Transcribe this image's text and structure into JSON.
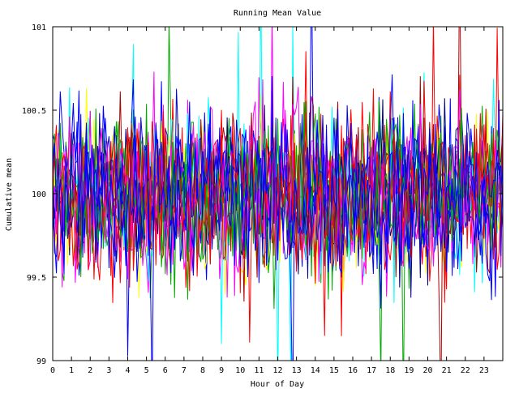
{
  "chart_data": {
    "type": "line",
    "title": "Running Mean Value",
    "xlabel": "Hour of Day",
    "ylabel": "Cumulative mean",
    "xlim": [
      0,
      24
    ],
    "ylim": [
      99,
      101
    ],
    "x_ticks": [
      "0",
      "1",
      "2",
      "3",
      "4",
      "5",
      "6",
      "7",
      "8",
      "9",
      "10",
      "11",
      "12",
      "13",
      "14",
      "15",
      "16",
      "17",
      "18",
      "19",
      "20",
      "21",
      "22",
      "23"
    ],
    "y_ticks": [
      "99",
      "99.5",
      "100",
      "100.5",
      "101"
    ],
    "grid": false,
    "legend": "none",
    "series_count": 16,
    "samples_per_hour": 10,
    "series_colors": [
      "#ff0000",
      "#00aa00",
      "#0000ff",
      "#ff00ff",
      "#00ffff",
      "#ffff00",
      "#aa0000",
      "#000080",
      "#ff0000",
      "#00aa00",
      "#0000ff",
      "#ff00ff",
      "#0000ff",
      "#00aa00",
      "#ff0000",
      "#0000ff"
    ],
    "typical_range": [
      99.55,
      100.45
    ],
    "note_values": "Dense overplotted random-walk lines fluctuating around 100; occasional spikes reach 99.2–100.8 and a few vertical excursions leave the plot range."
  }
}
